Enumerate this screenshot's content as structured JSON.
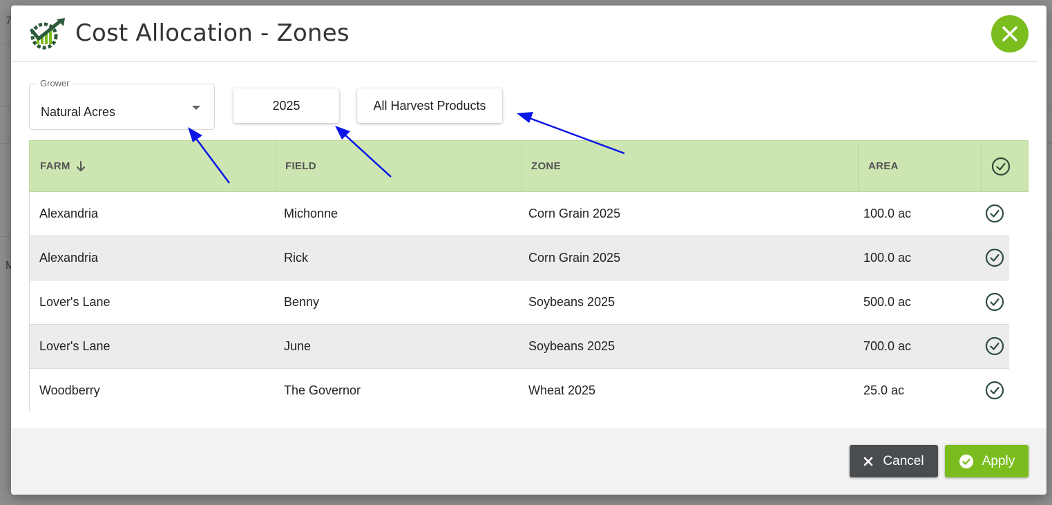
{
  "colors": {
    "accent": "#7bbd1e",
    "header_green": "#cde5b0",
    "check_color": "#2e4d3b",
    "cancel_bg": "#4a4d50",
    "annotation_arrow": "#0a15e8"
  },
  "background": {
    "left_digit": "7",
    "left_letter": "M"
  },
  "dialog": {
    "logo_icon": "growth-gear-logo-icon",
    "title": "Cost Allocation - Zones",
    "close_icon": "close-icon"
  },
  "filters": {
    "grower_label": "Grower",
    "grower_value": "Natural Acres",
    "year_label": "2025",
    "products_label": "All Harvest Products"
  },
  "table": {
    "columns": {
      "farm": "FARM",
      "field": "FIELD",
      "zone": "ZONE",
      "area": "AREA"
    },
    "sort_icon": "arrow-down-icon",
    "select_all_icon": "check-circle-icon",
    "rows": [
      {
        "farm": "Alexandria",
        "field": "Michonne",
        "zone": "Corn Grain 2025",
        "area": "100.0 ac",
        "selected": true
      },
      {
        "farm": "Alexandria",
        "field": "Rick",
        "zone": "Corn Grain 2025",
        "area": "100.0 ac",
        "selected": true
      },
      {
        "farm": "Lover's Lane",
        "field": "Benny",
        "zone": "Soybeans 2025",
        "area": "500.0 ac",
        "selected": true
      },
      {
        "farm": "Lover's Lane",
        "field": "June",
        "zone": "Soybeans 2025",
        "area": "700.0 ac",
        "selected": true
      },
      {
        "farm": "Woodberry",
        "field": "The Governor",
        "zone": "Wheat 2025",
        "area": "25.0 ac",
        "selected": true
      }
    ]
  },
  "footer": {
    "cancel_label": "Cancel",
    "apply_label": "Apply"
  }
}
